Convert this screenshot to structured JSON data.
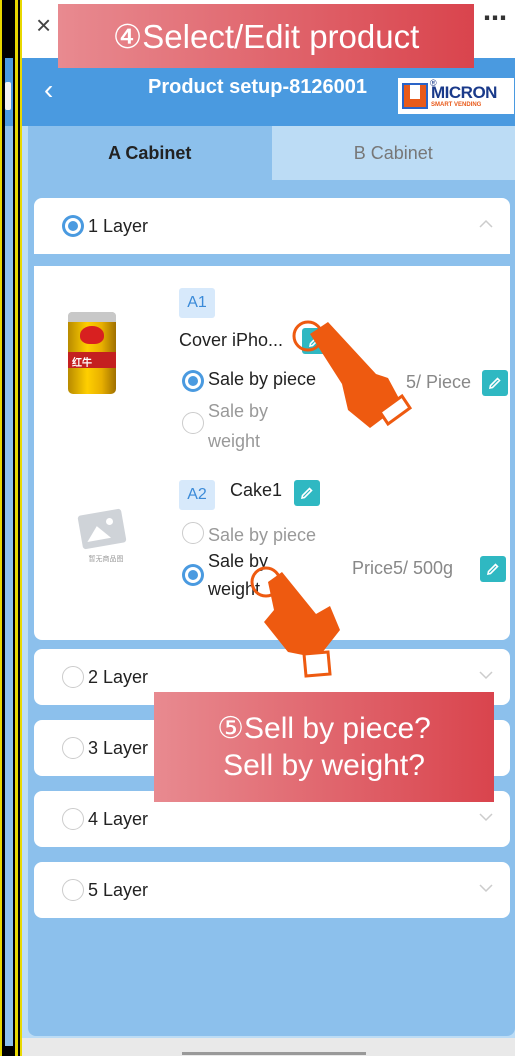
{
  "top_bar": {
    "close_icon": "×",
    "more_icon": "⋯"
  },
  "caption_top": "④Select/Edit product",
  "header": {
    "back_icon": "‹",
    "title": "Product setup-8126001",
    "logo": {
      "main": "MICRON",
      "sub": "SMART VENDING",
      "reg": "®"
    }
  },
  "tabs": [
    {
      "label": "A Cabinet",
      "active": true
    },
    {
      "label": "B Cabinet",
      "active": false
    }
  ],
  "layers": [
    {
      "label": "1 Layer",
      "selected": true,
      "expanded": true
    },
    {
      "label": "2 Layer",
      "selected": false,
      "expanded": false
    },
    {
      "label": "3 Layer",
      "selected": false,
      "expanded": false
    },
    {
      "label": "4 Layer",
      "selected": false,
      "expanded": false
    },
    {
      "label": "5 Layer",
      "selected": false,
      "expanded": false
    }
  ],
  "products": [
    {
      "slot": "A1",
      "name": "Cover iPho...",
      "image": "red-bull-can",
      "image_text": "红牛",
      "options": [
        {
          "label": "Sale by piece",
          "selected": true
        },
        {
          "label_line1": "Sale by",
          "label_line2": "weight",
          "selected": false
        }
      ],
      "price": "5/ Piece"
    },
    {
      "slot": "A2",
      "name": "Cake1",
      "image": "placeholder-image",
      "image_caption": "暂无商品图",
      "options": [
        {
          "label": "Sale by piece",
          "selected": false
        },
        {
          "label_line1": "Sale by",
          "label_line2": "weight",
          "selected": true
        }
      ],
      "price": "Price5/ 500g"
    }
  ],
  "caption_bottom": {
    "line1": "⑤Sell by piece?",
    "line2": "Sell by weight?"
  },
  "icons": {
    "edit": "pencil-icon",
    "chevron_up": "chevron-up-icon",
    "chevron_down": "chevron-down-icon",
    "pointer": "hand-pointer-icon"
  },
  "colors": {
    "header": "#4a9ae0",
    "panel": "#8cc0ec",
    "edit": "#2fb8c2",
    "caption": "#d9444d",
    "hand": "#ee5a10"
  }
}
